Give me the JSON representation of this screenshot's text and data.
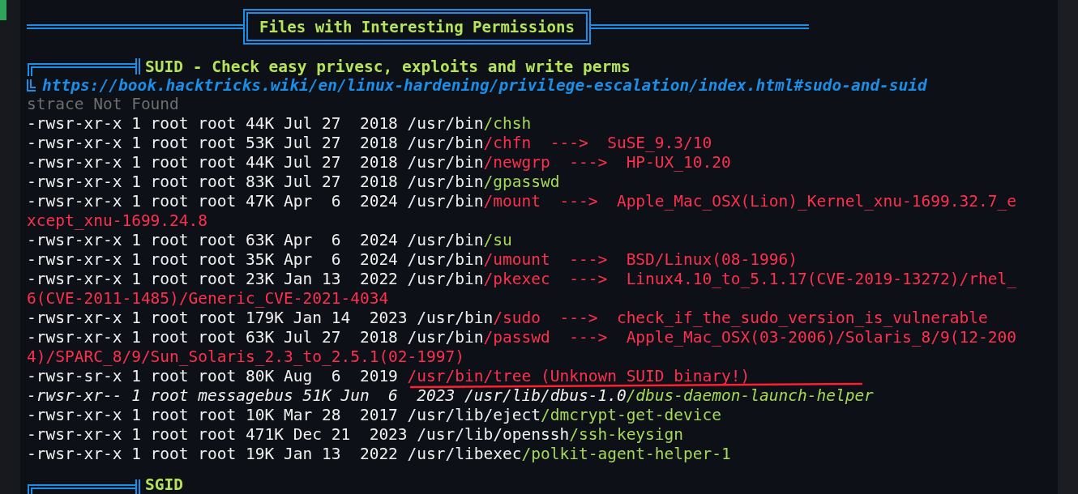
{
  "banner": {
    "title": "Files with Interesting Permissions"
  },
  "section": {
    "title": "SUID - Check easy privesc, exploits and write perms",
    "link": "https://book.hacktricks.wiki/en/linux-hardening/privilege-escalation/index.html#sudo-and-suid"
  },
  "lines": [
    {
      "segments": [
        {
          "text": "strace Not Found",
          "kind": "gray"
        }
      ]
    },
    {
      "segments": [
        {
          "text": "-rwsr-xr-x 1 root root 44K Jul 27  2018 /usr/bin",
          "kind": "plain"
        },
        {
          "text": "/chsh",
          "kind": "green"
        }
      ]
    },
    {
      "segments": [
        {
          "text": "-rwsr-xr-x 1 root root 53K Jul 27  2018 /usr/bin",
          "kind": "plain"
        },
        {
          "text": "/chfn  --->  SuSE_9.3/10",
          "kind": "red"
        }
      ]
    },
    {
      "segments": [
        {
          "text": "-rwsr-xr-x 1 root root 44K Jul 27  2018 /usr/bin",
          "kind": "plain"
        },
        {
          "text": "/newgrp  --->  HP-UX_10.20",
          "kind": "red"
        }
      ]
    },
    {
      "segments": [
        {
          "text": "-rwsr-xr-x 1 root root 83K Jul 27  2018 /usr/bin",
          "kind": "plain"
        },
        {
          "text": "/gpasswd",
          "kind": "green"
        }
      ]
    },
    {
      "segments": [
        {
          "text": "-rwsr-xr-x 1 root root 47K Apr  6  2024 /usr/bin",
          "kind": "plain"
        },
        {
          "text": "/mount  --->  Apple_Mac_OSX(Lion)_Kernel_xnu-1699.32.7_e",
          "kind": "red"
        }
      ]
    },
    {
      "segments": [
        {
          "text": "xcept_xnu-1699.24.8",
          "kind": "red"
        }
      ]
    },
    {
      "segments": [
        {
          "text": "-rwsr-xr-x 1 root root 63K Apr  6  2024 /usr/bin",
          "kind": "plain"
        },
        {
          "text": "/su",
          "kind": "green"
        }
      ]
    },
    {
      "segments": [
        {
          "text": "-rwsr-xr-x 1 root root 35K Apr  6  2024 /usr/bin",
          "kind": "plain"
        },
        {
          "text": "/umount  --->  BSD/Linux(08-1996)",
          "kind": "red"
        }
      ]
    },
    {
      "segments": [
        {
          "text": "-rwsr-xr-x 1 root root 23K Jan 13  2022 /usr/bin",
          "kind": "plain"
        },
        {
          "text": "/pkexec  --->  Linux4.10_to_5.1.17(CVE-2019-13272)/rhel_",
          "kind": "red"
        }
      ]
    },
    {
      "segments": [
        {
          "text": "6(CVE-2011-1485)/Generic_CVE-2021-4034",
          "kind": "red"
        }
      ]
    },
    {
      "segments": [
        {
          "text": "-rwsr-xr-x 1 root root 179K Jan 14  2023 /usr/bin",
          "kind": "plain"
        },
        {
          "text": "/sudo  --->  check_if_the_sudo_version_is_vulnerable",
          "kind": "red"
        }
      ]
    },
    {
      "segments": [
        {
          "text": "-rwsr-xr-x 1 root root 63K Jul 27  2018 /usr/bin",
          "kind": "plain"
        },
        {
          "text": "/passwd  --->  Apple_Mac_OSX(03-2006)/Solaris_8/9(12-200",
          "kind": "red"
        }
      ]
    },
    {
      "segments": [
        {
          "text": "4)/SPARC_8/9/Sun_Solaris_2.3_to_2.5.1(02-1997)",
          "kind": "red"
        }
      ]
    },
    {
      "segments": [
        {
          "text": "-rwsr-sr-x 1 root root 80K Aug  6  2019 ",
          "kind": "plain"
        },
        {
          "text": "/usr/bin/tree (Unknown SUID binary!)",
          "kind": "red"
        }
      ]
    },
    {
      "segments": [
        {
          "text": "-rwsr-xr-- 1 root messagebus 51K Jun  6  2023 /usr/lib/dbus-1.0",
          "kind": "italic"
        },
        {
          "text": "/dbus-daemon-launch-helper",
          "kind": "italic-green"
        }
      ]
    },
    {
      "segments": [
        {
          "text": "-rwsr-xr-x 1 root root 10K Mar 28  2017 /usr/lib/eject",
          "kind": "plain"
        },
        {
          "text": "/dmcrypt-get-device",
          "kind": "green"
        }
      ]
    },
    {
      "segments": [
        {
          "text": "-rwsr-xr-x 1 root root 471K Dec 21  2023 /usr/lib/openssh",
          "kind": "plain"
        },
        {
          "text": "/ssh-keysign",
          "kind": "green"
        }
      ]
    },
    {
      "segments": [
        {
          "text": "-rwsr-xr-x 1 root root 19K Jan 13  2022 /usr/libexec",
          "kind": "plain"
        },
        {
          "text": "/polkit-agent-helper-1",
          "kind": "green"
        }
      ]
    }
  ],
  "next_section": {
    "title": "SGID"
  }
}
